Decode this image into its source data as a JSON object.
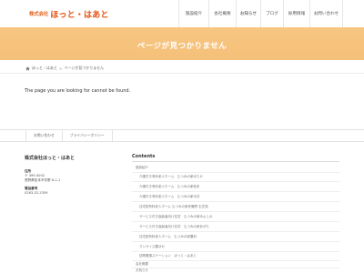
{
  "header": {
    "logo_prefix": "株式会社",
    "logo_main": "ほっと・はあと",
    "nav": [
      {
        "label": "施設紹介"
      },
      {
        "label": "会社概要"
      },
      {
        "label": "お知らせ"
      },
      {
        "label": "ブログ"
      },
      {
        "label": "採用情報"
      },
      {
        "label": "お問い合わせ"
      }
    ]
  },
  "banner": {
    "title": "ページが見つかりません"
  },
  "breadcrumb": {
    "home": "ほっと・はあと",
    "separator": ">",
    "current": "ページが見つかりません"
  },
  "main": {
    "message": "The page you are looking for cannot be found."
  },
  "footer_nav": [
    {
      "label": "お問い合わせ"
    },
    {
      "label": "プライバシーポリシー"
    }
  ],
  "company": {
    "name": "株式会社ほっと・はあと",
    "address_label": "住所",
    "postal": "〒 399-0002",
    "address": "長野県松本市芳野 8-1-1",
    "tel_label": "電話番号",
    "tel": "0263-52-2359"
  },
  "contents": {
    "title": "Contents",
    "items": [
      {
        "label": "施設紹介",
        "level": 0
      },
      {
        "label": "介護付き有料老人ホーム　むつみの家ほたか",
        "level": 1
      },
      {
        "label": "介護付き有料老人ホーム　むつみの家松本",
        "level": 1
      },
      {
        "label": "介護付き有料老人ホーム　むつみの家今井",
        "level": 1
      },
      {
        "label": "住宅型有料老人ホーム むつみの家安曇野 石芝苑",
        "level": 1
      },
      {
        "label": "サービス付き高齢者向け住宅　むつみの家みよしの",
        "level": 1
      },
      {
        "label": "サービス付き高齢者向け住宅　むつみの家あがた",
        "level": 1
      },
      {
        "label": "住宅型有料老人ホーム　むつみの家豊科",
        "level": 1
      },
      {
        "label": "マンサイス豊ほか",
        "level": 1
      },
      {
        "label": "訪問看護ステーション　ほっと・はあと",
        "level": 1
      },
      {
        "label": "会社概要",
        "level": 0
      },
      {
        "label": "お知らせ",
        "level": 0
      }
    ]
  },
  "colors": {
    "accent": "#e8652a",
    "banner": "#f6c37d"
  }
}
